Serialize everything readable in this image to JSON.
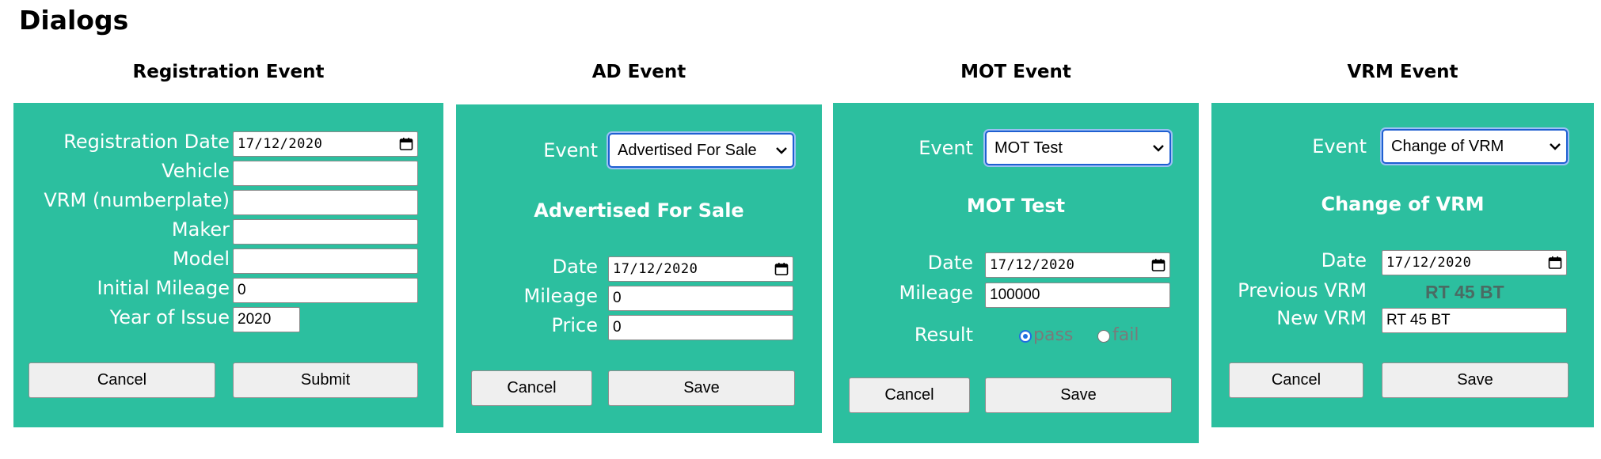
{
  "page": {
    "title": "Dialogs"
  },
  "icons": {
    "calendar": "calendar-icon",
    "dropdown": "chevron-down-icon"
  },
  "colors": {
    "panel": "#2cbf9f",
    "label_text": "#ffffff",
    "select_focus": "#1f5fd1",
    "radio_checked": "#1f6fe0"
  },
  "registration": {
    "heading": "Registration Event",
    "labels": {
      "registration_date": "Registration Date",
      "vehicle": "Vehicle",
      "vrm": "VRM (numberplate)",
      "maker": "Maker",
      "model": "Model",
      "initial_mileage": "Initial Mileage",
      "year_of_issue": "Year of Issue"
    },
    "values": {
      "registration_date": "17/12/2020",
      "vehicle": "",
      "vrm": "",
      "maker": "",
      "model": "",
      "initial_mileage": "0",
      "year_of_issue": "2020"
    },
    "cancel_label": "Cancel",
    "submit_label": "Submit"
  },
  "ad": {
    "heading": "AD Event",
    "event_label": "Event",
    "event_selected": "Advertised For Sale",
    "subtitle": "Advertised For Sale",
    "labels": {
      "date": "Date",
      "mileage": "Mileage",
      "price": "Price"
    },
    "values": {
      "date": "17/12/2020",
      "mileage": "0",
      "price": "0"
    },
    "cancel_label": "Cancel",
    "save_label": "Save"
  },
  "mot": {
    "heading": "MOT Event",
    "event_label": "Event",
    "event_selected": "MOT Test",
    "subtitle": "MOT Test",
    "labels": {
      "date": "Date",
      "mileage": "Mileage",
      "result": "Result"
    },
    "values": {
      "date": "17/12/2020",
      "mileage": "100000"
    },
    "result_options": [
      "pass",
      "fail"
    ],
    "result_selected": "pass",
    "cancel_label": "Cancel",
    "save_label": "Save"
  },
  "vrm": {
    "heading": "VRM Event",
    "event_label": "Event",
    "event_selected": "Change of VRM",
    "subtitle": "Change of VRM",
    "labels": {
      "date": "Date",
      "previous_vrm": "Previous VRM",
      "new_vrm": "New VRM"
    },
    "values": {
      "date": "17/12/2020",
      "previous_vrm": "RT 45 BT",
      "new_vrm": "RT 45 BT"
    },
    "cancel_label": "Cancel",
    "save_label": "Save"
  }
}
